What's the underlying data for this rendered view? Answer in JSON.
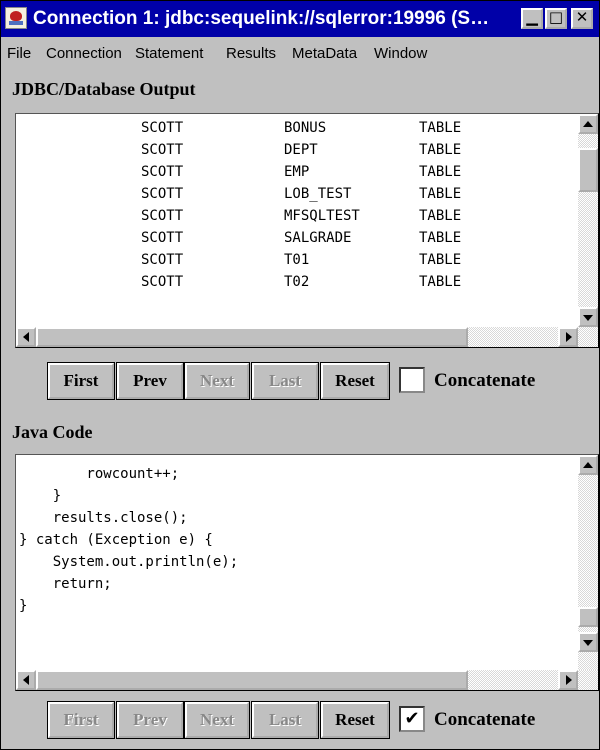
{
  "window": {
    "title": "Connection 1: jdbc:sequelink://sqlerror:19996 (S…",
    "controls": {
      "minimize": "▁",
      "maximize": "□",
      "close": "✕"
    }
  },
  "menu": [
    "File",
    "Connection",
    "Statement",
    "Results",
    "MetaData",
    "Window"
  ],
  "output": {
    "label": "JDBC/Database Output",
    "rows": [
      [
        "SCOTT",
        "BONUS",
        "TABLE"
      ],
      [
        "SCOTT",
        "DEPT",
        "TABLE"
      ],
      [
        "SCOTT",
        "EMP",
        "TABLE"
      ],
      [
        "SCOTT",
        "LOB_TEST",
        "TABLE"
      ],
      [
        "SCOTT",
        "MFSQLTEST",
        "TABLE"
      ],
      [
        "SCOTT",
        "SALGRADE",
        "TABLE"
      ],
      [
        "SCOTT",
        "T01",
        "TABLE"
      ],
      [
        "SCOTT",
        "T02",
        "TABLE"
      ]
    ],
    "nav": {
      "first": "First",
      "prev": "Prev",
      "next": "Next",
      "last": "Last",
      "reset": "Reset",
      "concatenate": "Concatenate",
      "concatenate_checked": "",
      "enabled": {
        "first": true,
        "prev": true,
        "next": false,
        "last": false,
        "reset": true
      }
    }
  },
  "code": {
    "label": "Java Code",
    "lines": [
      "        rowcount++;",
      "    }",
      "    results.close();",
      "} catch (Exception e) {",
      "    System.out.println(e);",
      "    return;",
      "}"
    ],
    "nav": {
      "first": "First",
      "prev": "Prev",
      "next": "Next",
      "last": "Last",
      "reset": "Reset",
      "concatenate": "Concatenate",
      "concatenate_checked": "✔",
      "enabled": {
        "first": false,
        "prev": false,
        "next": false,
        "last": false,
        "reset": true
      }
    }
  },
  "colors": {
    "titlebar": "#0000a8",
    "chrome": "#c0c0c0",
    "disabled_text": "#888888"
  }
}
